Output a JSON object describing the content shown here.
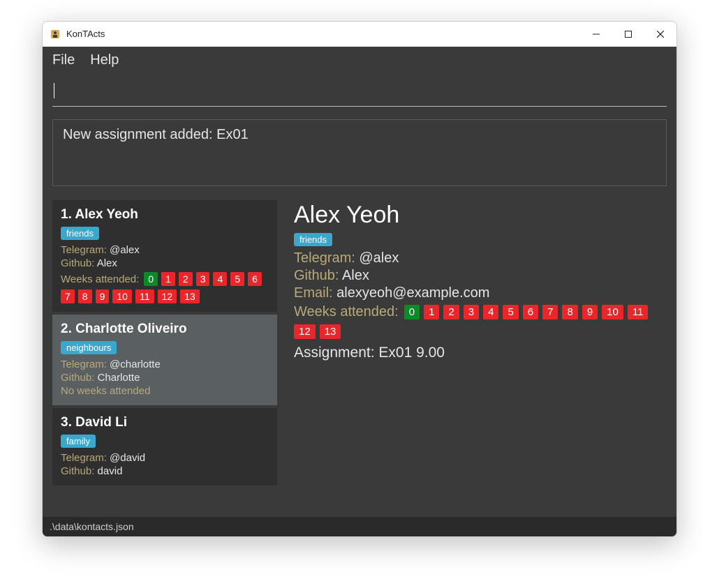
{
  "window": {
    "title": "KonTActs"
  },
  "menu": {
    "file": "File",
    "help": "Help"
  },
  "command": {
    "placeholder": ""
  },
  "status": {
    "message": "New assignment added: Ex01"
  },
  "labels": {
    "telegram": "Telegram:",
    "github": "Github:",
    "email": "Email:",
    "weeks_attended": "Weeks attended:",
    "no_weeks": "No weeks attended",
    "assignment": "Assignment:"
  },
  "contacts": [
    {
      "index": "1.",
      "name": "Alex Yeoh",
      "tag": "friends",
      "telegram": "@alex",
      "github": "Alex",
      "weeks": [
        "0",
        "1",
        "2",
        "3",
        "4",
        "5",
        "6",
        "7",
        "8",
        "9",
        "10",
        "11",
        "12",
        "13"
      ],
      "weeks_green": [
        "0"
      ],
      "selected": false
    },
    {
      "index": "2.",
      "name": "Charlotte Oliveiro",
      "tag": "neighbours",
      "telegram": "@charlotte",
      "github": "Charlotte",
      "weeks": [],
      "selected": true
    },
    {
      "index": "3.",
      "name": "David Li",
      "tag": "family",
      "telegram": "@david",
      "github": "david",
      "weeks": [],
      "selected": false,
      "hide_no_weeks": true
    }
  ],
  "detail": {
    "name": "Alex Yeoh",
    "tag": "friends",
    "telegram": "@alex",
    "github": "Alex",
    "email": "alexyeoh@example.com",
    "weeks": [
      "0",
      "1",
      "2",
      "3",
      "4",
      "5",
      "6",
      "7",
      "8",
      "9",
      "10",
      "11",
      "12",
      "13"
    ],
    "weeks_green": [
      "0"
    ],
    "assignment": "Ex01 9.00"
  },
  "footer": {
    "path": ".\\data\\kontacts.json"
  },
  "colors": {
    "tag_bg": "#3aa7cc",
    "week_red": "#e9262a",
    "week_green": "#0c8a28",
    "field_label": "#b8aa7a",
    "panel_bg": "#3a3a3a",
    "card_bg": "#2f2f2f",
    "card_selected_bg": "#5a5f62"
  }
}
